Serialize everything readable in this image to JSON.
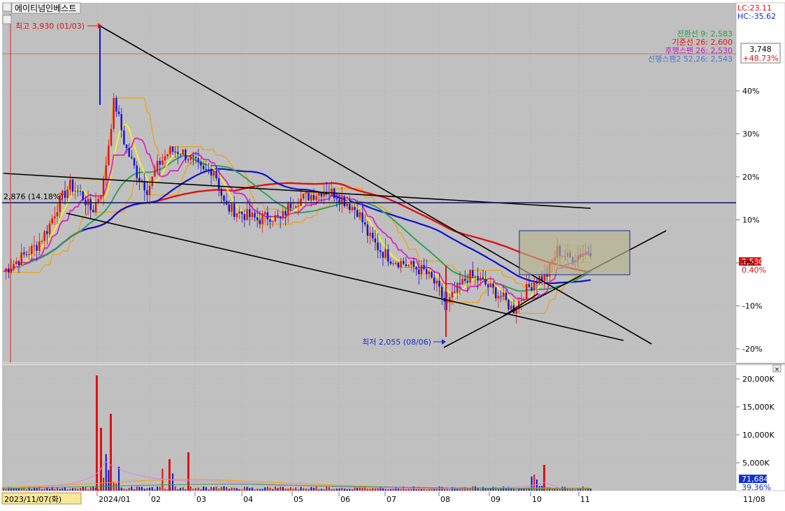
{
  "header": {
    "title": "에이티넘인베스트",
    "lc": "LC:23.11",
    "hc": "HC:-35.62"
  },
  "legend": [
    {
      "label": "전환선 9: 2,583",
      "color": "#20a040"
    },
    {
      "label": "기준선 26: 2,600",
      "color": "#e81010"
    },
    {
      "label": "후행스팬 26: 2,530",
      "color": "#c020c0"
    },
    {
      "label": "선행스팬2 52,26: 2,543",
      "color": "#4a78d8"
    }
  ],
  "price_panel": {
    "last_price_box": [
      "3,748",
      "+48.73%"
    ],
    "current_price_label": "2,530",
    "current_change_label": "0.40%",
    "high_annotation": "최고 3,930 (01/03)",
    "low_annotation": "최저 2,055 (08/06)",
    "level_annotation": "2,876 (14.18%)",
    "y_ticks": [
      "40%",
      "30%",
      "20%",
      "10%",
      "0%",
      "-10%",
      "-20%"
    ]
  },
  "volume_panel": {
    "y_ticks": [
      "20,000K",
      "15,000K",
      "10,000K",
      "5,000K"
    ],
    "last_volume_label": "71,684",
    "last_volume_change": "39.36%"
  },
  "x_axis": {
    "start_label": "2023/11/07(화)",
    "ticks": [
      "2024/01",
      "02",
      "03",
      "04",
      "05",
      "06",
      "07",
      "08",
      "09",
      "10",
      "11"
    ],
    "end_label": "11/08"
  },
  "chart_data": {
    "type": "line",
    "title": "에이티넘인베스트",
    "x_range": [
      "2023/11/07",
      "2024/11/08"
    ],
    "ylabel_unit": "% change from base",
    "ylim_pct": [
      -22,
      50
    ],
    "annotations": {
      "high": {
        "price": 3930,
        "date": "01/03"
      },
      "low": {
        "price": 2055,
        "date": "08/06"
      },
      "level": {
        "price": 2876,
        "pct": 14.18
      },
      "last": {
        "price": 2530,
        "pct": 0.4
      },
      "ref": {
        "price": 3748,
        "pct": 48.73
      }
    },
    "series": [
      {
        "name": "price",
        "approx_pct": [
          -2,
          0,
          2,
          4,
          8,
          14,
          18,
          16,
          12,
          18,
          38,
          27,
          21,
          17,
          23,
          26,
          26,
          24,
          21,
          22,
          13,
          12,
          11,
          10,
          11,
          10,
          14,
          15,
          16,
          17,
          16,
          14,
          12,
          6,
          3,
          1,
          0,
          -1,
          -2,
          -5,
          -10,
          -6,
          -3,
          -4,
          -6,
          -8,
          -11,
          -7,
          -4,
          -3,
          3,
          1,
          2,
          3
        ]
      },
      {
        "name": "전환선 9",
        "value": 2583
      },
      {
        "name": "기준선 26",
        "value": 2600
      },
      {
        "name": "후행스팬 26",
        "value": 2530
      },
      {
        "name": "선행스팬2 52,26",
        "value": 2543
      }
    ]
  }
}
